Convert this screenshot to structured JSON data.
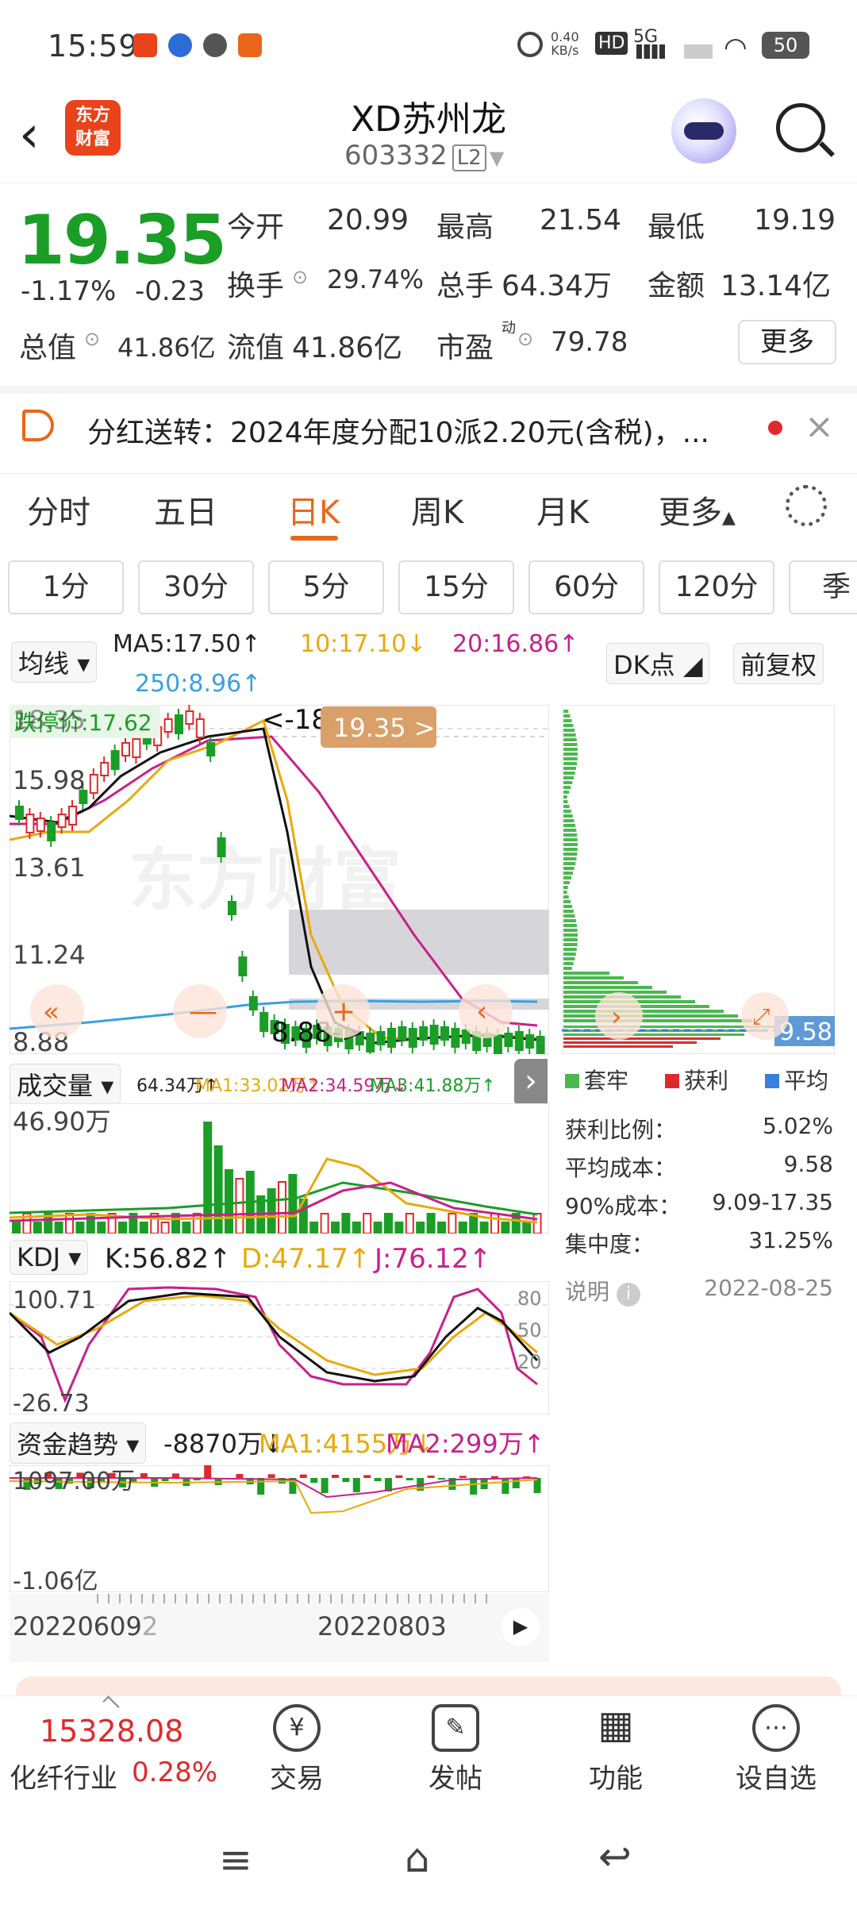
{
  "status_bar": {
    "time": "15:59",
    "net_speed": "0.40\nKB/s",
    "net_speed_line1": "0.40",
    "net_speed_line2": "KB/s",
    "hd_label": "HD",
    "network_label": "5G",
    "battery": "50"
  },
  "header": {
    "logo_text_line1": "东方",
    "logo_text_line2": "财富",
    "stock_name": "XD苏州龙",
    "stock_code": "603332",
    "level_badge": "L2"
  },
  "quote": {
    "price": "19.35",
    "change_pct": "-1.17%",
    "change_abs": "-0.23",
    "open_label": "今开",
    "open_value": "20.99",
    "high_label": "最高",
    "high_value": "21.54",
    "low_label": "最低",
    "low_value": "19.19",
    "turnover_label": "换手",
    "turnover_value": "29.74%",
    "volume_label": "总手",
    "volume_value": "64.34万",
    "amount_label": "金额",
    "amount_value": "13.14亿",
    "mktcap_label": "总值",
    "mktcap_value": "41.86亿",
    "float_label": "流值",
    "float_value": "41.86亿",
    "pe_label": "市盈",
    "pe_sup": "动",
    "pe_value": "79.78",
    "more_label": "更多"
  },
  "notice": {
    "text": "分红送转：2024年度分配10派2.20元(含税)，..."
  },
  "tabs": [
    "分时",
    "五日",
    "日K",
    "周K",
    "月K",
    "更多"
  ],
  "active_tab": "日K",
  "periods": [
    "1分",
    "30分",
    "5分",
    "15分",
    "60分",
    "120分",
    "季"
  ],
  "main_chart": {
    "indicator_selector": "均线",
    "ma5": "MA5:17.50↑",
    "ma10": "10:17.10↓",
    "ma20": "20:16.86↑",
    "ma250": "250:8.96↑",
    "dk_label": "DK点",
    "adjust_label": "前复权",
    "limit_down_label": "跌停价:17.62",
    "current_bubble": "19.35 >",
    "y_ticks": [
      "18.35",
      "15.98",
      "13.61",
      "11.24",
      "8.88"
    ],
    "high_marker": "<-18.35",
    "low_marker": "8.88->",
    "watermark": "东方财富"
  },
  "chip_panel": {
    "avg_cost_tag": "9.58",
    "legend_trapped": "套牢",
    "legend_profit": "获利",
    "legend_avg": "平均",
    "profit_ratio_label": "获利比例：",
    "profit_ratio_value": "5.02%",
    "avg_cost_label": "平均成本：",
    "avg_cost_value": "9.58",
    "cost90_label": "90%成本：",
    "cost90_value": "9.09-17.35",
    "concentration_label": "集中度：",
    "concentration_value": "31.25%",
    "note_label": "说明",
    "date": "2022-08-25"
  },
  "volume_chart": {
    "selector": "成交量",
    "vol": "64.34万↑",
    "ma1": "MA1:33.02万↑",
    "ma2": "MA2:34.59万↓",
    "ma3": "MA3:41.88万↑",
    "y_max": "46.90万"
  },
  "kdj_chart": {
    "selector": "KDJ",
    "k": "K:56.82↑",
    "d": "D:47.17↑",
    "j": "J:76.12↑",
    "y_max": "100.71",
    "y_min": "-26.73",
    "levels": [
      "80",
      "50",
      "20"
    ]
  },
  "fund_chart": {
    "selector": "资金趋势",
    "value": "-8870万↓",
    "ma1": "MA1:4155万↓",
    "ma2": "MA2:299万↑",
    "y_max": "1097.00万",
    "y_min": "-1.06亿"
  },
  "date_axis": {
    "left": "20220609",
    "left_partial": "2",
    "middle": "20220803"
  },
  "bottom_bar": {
    "index_value": "15328.08",
    "index_name": "化纤行业",
    "index_change": "0.28%",
    "items": [
      "交易",
      "发帖",
      "功能",
      "设自选"
    ]
  },
  "colors": {
    "up": "#e0292b",
    "down": "#1a9e26",
    "accent": "#e8671a",
    "ma10": "#e8a90a",
    "ma20": "#c8208a",
    "ma250": "#3aa0e0"
  }
}
